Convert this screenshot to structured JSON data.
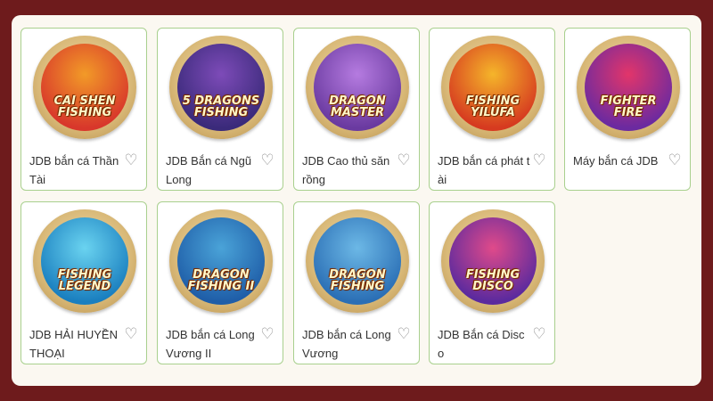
{
  "games": [
    {
      "name": "JDB bắn cá Thần Tài",
      "logo_lines": [
        "CAI SHEN",
        "FISHING"
      ],
      "bg": [
        "#d8372b",
        "#f29a28"
      ]
    },
    {
      "name": "JDB Bắn cá Ngũ Long",
      "logo_lines": [
        "5 DRAGONS",
        "FISHING"
      ],
      "bg": [
        "#3a2a7a",
        "#7d4bb8"
      ]
    },
    {
      "name": "JDB Cao thủ săn rồng",
      "logo_lines": [
        "DRAGON",
        "MASTER"
      ],
      "bg": [
        "#6a3aa0",
        "#b57be0"
      ]
    },
    {
      "name": "JDB bắn cá phát tài",
      "logo_lines": [
        "FISHING",
        "YILUFA"
      ],
      "bg": [
        "#d63a20",
        "#f5b52a"
      ]
    },
    {
      "name": "Máy bắn cá JDB",
      "logo_lines": [
        "FIGHTER",
        "FIRE"
      ],
      "bg": [
        "#6b2aa0",
        "#e2356a"
      ]
    },
    {
      "name": "JDB HẢI HUYỀN THOẠI",
      "logo_lines": [
        "FISHING",
        "LEGEND"
      ],
      "bg": [
        "#1a7fbf",
        "#6ad3f0"
      ]
    },
    {
      "name": "JDB bắn cá Long Vương II",
      "logo_lines": [
        "DRAGON",
        "FISHING II"
      ],
      "bg": [
        "#1f5ea8",
        "#4aa3d8"
      ]
    },
    {
      "name": "JDB bắn cá Long Vương",
      "logo_lines": [
        "DRAGON",
        "FISHING"
      ],
      "bg": [
        "#2b6fb5",
        "#6cb8e6"
      ]
    },
    {
      "name": "JDB Bắn cá Disco",
      "logo_lines": [
        "FISHING DISCO"
      ],
      "bg": [
        "#5b2a9e",
        "#e04a8a"
      ]
    }
  ],
  "favorite_icon": "heart-outline-icon"
}
